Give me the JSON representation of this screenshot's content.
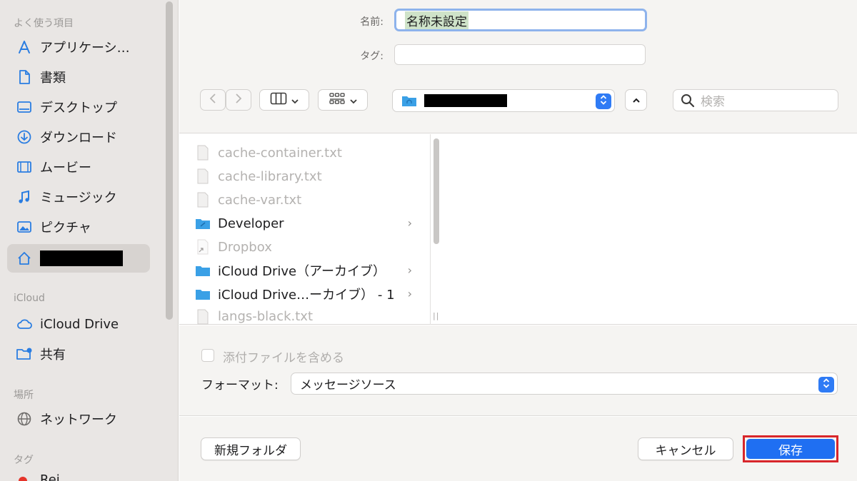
{
  "sidebar": {
    "favorites_header": "よく使う項目",
    "favorites": [
      {
        "label": "アプリケーシ…",
        "icon": "applications-icon"
      },
      {
        "label": "書類",
        "icon": "document-icon"
      },
      {
        "label": "デスクトップ",
        "icon": "desktop-icon"
      },
      {
        "label": "ダウンロード",
        "icon": "download-icon"
      },
      {
        "label": "ムービー",
        "icon": "film-icon"
      },
      {
        "label": "ミュージック",
        "icon": "music-icon"
      },
      {
        "label": "ピクチャ",
        "icon": "picture-icon"
      },
      {
        "label": "",
        "icon": "home-icon",
        "redacted": true
      }
    ],
    "icloud_header": "iCloud",
    "icloud": [
      {
        "label": "iCloud Drive",
        "icon": "cloud-icon"
      },
      {
        "label": "共有",
        "icon": "shared-folder-icon"
      }
    ],
    "locations_header": "場所",
    "locations": [
      {
        "label": "ネットワーク",
        "icon": "globe-icon"
      }
    ],
    "tags_header": "タグ",
    "tags": [
      {
        "label": "Rei",
        "color": "#e5342a"
      }
    ]
  },
  "form": {
    "name_label": "名前:",
    "name_value": "名称未設定",
    "tag_label": "タグ:",
    "tag_value": ""
  },
  "toolbar": {
    "back_icon": "chevron-left-icon",
    "forward_icon": "chevron-right-icon",
    "view_icon": "columns-view-icon",
    "group_icon": "grid-icon",
    "location_icon": "home-folder-icon",
    "location_redacted": true,
    "search_placeholder": "検索"
  },
  "files": [
    {
      "name": "cache-container.txt",
      "kind": "txt",
      "dim": true
    },
    {
      "name": "cache-library.txt",
      "kind": "txt",
      "dim": true
    },
    {
      "name": "cache-var.txt",
      "kind": "txt",
      "dim": true
    },
    {
      "name": "Developer",
      "kind": "folder",
      "dim": false,
      "chevron": "›"
    },
    {
      "name": "Dropbox",
      "kind": "alias",
      "dim": true
    },
    {
      "name": "iCloud Drive（アーカイブ）",
      "kind": "folder",
      "dim": false,
      "chevron": "›"
    },
    {
      "name": "iCloud Drive…ーカイブ） - 1",
      "kind": "folder",
      "dim": false,
      "chevron": "›"
    },
    {
      "name": "langs-black.txt",
      "kind": "txt",
      "dim": true
    }
  ],
  "options": {
    "attach_label": "添付ファイルを含める",
    "attach_checked": false,
    "format_label": "フォーマット:",
    "format_value": "メッセージソース"
  },
  "buttons": {
    "new_folder": "新規フォルダ",
    "cancel": "キャンセル",
    "save": "保存"
  },
  "colors": {
    "accent": "#1f6ff2",
    "highlight_box": "#d8262b",
    "folder": "#3aa0e6"
  }
}
